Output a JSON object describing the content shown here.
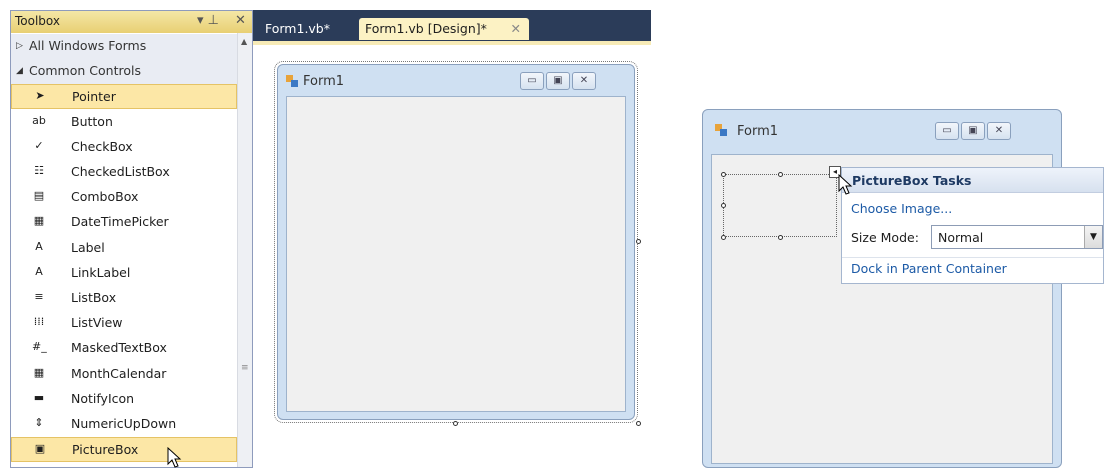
{
  "toolbox": {
    "title": "Toolbox",
    "pin_glyph": "▾ ⊥",
    "close_glyph": "✕",
    "items": [
      {
        "label": "All Windows Forms",
        "kind": "category",
        "arrow": "▷"
      },
      {
        "label": "Common Controls",
        "kind": "category",
        "arrow": "◢"
      },
      {
        "label": "Pointer",
        "icon": "pointer-icon",
        "glyph": "➤",
        "selected": true
      },
      {
        "label": "Button",
        "icon": "button-icon",
        "glyph": "ab"
      },
      {
        "label": "CheckBox",
        "icon": "checkbox-icon",
        "glyph": "✓"
      },
      {
        "label": "CheckedListBox",
        "icon": "checkedlistbox-icon",
        "glyph": "☷"
      },
      {
        "label": "ComboBox",
        "icon": "combobox-icon",
        "glyph": "▤"
      },
      {
        "label": "DateTimePicker",
        "icon": "datetimepicker-icon",
        "glyph": "▦"
      },
      {
        "label": "Label",
        "icon": "label-icon",
        "glyph": "A"
      },
      {
        "label": "LinkLabel",
        "icon": "linklabel-icon",
        "glyph": "A"
      },
      {
        "label": "ListBox",
        "icon": "listbox-icon",
        "glyph": "≡"
      },
      {
        "label": "ListView",
        "icon": "listview-icon",
        "glyph": "⁞⁞⁞"
      },
      {
        "label": "MaskedTextBox",
        "icon": "maskedtextbox-icon",
        "glyph": "#_"
      },
      {
        "label": "MonthCalendar",
        "icon": "monthcalendar-icon",
        "glyph": "▦"
      },
      {
        "label": "NotifyIcon",
        "icon": "notifyicon-icon",
        "glyph": "▬"
      },
      {
        "label": "NumericUpDown",
        "icon": "numericupdown-icon",
        "glyph": "⇕"
      },
      {
        "label": "PictureBox",
        "icon": "picturebox-icon",
        "glyph": "▣",
        "selected": true
      }
    ]
  },
  "editor": {
    "tabs": [
      {
        "label": "Form1.vb*",
        "active": false
      },
      {
        "label": "Form1.vb [Design]*",
        "active": true,
        "close": "✕"
      }
    ]
  },
  "design_form": {
    "title": "Form1"
  },
  "runtime_form": {
    "title": "Form1"
  },
  "window_buttons": {
    "minimize": "▭",
    "maximize": "▣",
    "close": "✕"
  },
  "smart_tag": {
    "title": "PictureBox Tasks",
    "choose_image": "Choose Image...",
    "size_mode_label": "Size Mode:",
    "size_mode_value": "Normal",
    "dock_link": "Dock in Parent Container"
  },
  "colors": {
    "toolbox_header": "#e8cf73",
    "document_background": "#2b3c59",
    "active_tab": "#fcf2c4",
    "selection": "#fce7a6",
    "form_frame": "#cfe0f2",
    "link": "#1c5aa6"
  }
}
